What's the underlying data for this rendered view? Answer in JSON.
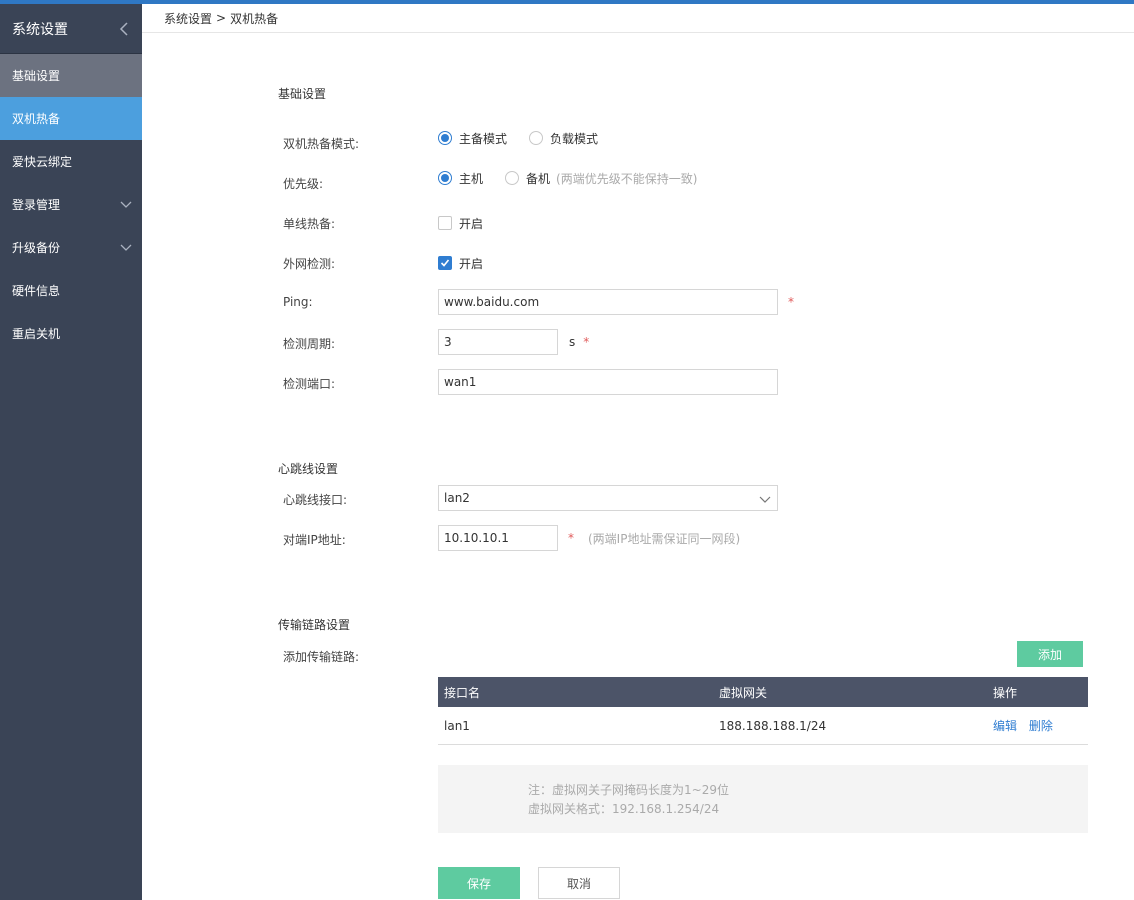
{
  "sidebar": {
    "title": "系统设置",
    "items": [
      {
        "label": "基础设置"
      },
      {
        "label": "双机热备"
      },
      {
        "label": "爱快云绑定"
      },
      {
        "label": "登录管理"
      },
      {
        "label": "升级备份"
      },
      {
        "label": "硬件信息"
      },
      {
        "label": "重启关机"
      }
    ]
  },
  "breadcrumb": {
    "parent": "系统设置",
    "separator": ">",
    "current": "双机热备"
  },
  "basic": {
    "title": "基础设置",
    "mode": {
      "label": "双机热备模式:",
      "options": [
        "主备模式",
        "负载模式"
      ],
      "selected": "主备模式"
    },
    "priority": {
      "label": "优先级:",
      "options": [
        "主机",
        "备机"
      ],
      "selected": "主机",
      "hint": "(两端优先级不能保持一致)"
    },
    "single_line": {
      "label": "单线热备:",
      "option": "开启",
      "checked": false
    },
    "wan_check": {
      "label": "外网检测:",
      "option": "开启",
      "checked": true
    },
    "ping": {
      "label": "Ping:",
      "value": "www.baidu.com",
      "required": "*"
    },
    "period": {
      "label": "检测周期:",
      "value": "3",
      "unit": "s",
      "required": "*"
    },
    "port": {
      "label": "检测端口:",
      "value": "wan1"
    }
  },
  "heartbeat": {
    "title": "心跳线设置",
    "interface": {
      "label": "心跳线接口:",
      "value": "lan2"
    },
    "peer_ip": {
      "label": "对端IP地址:",
      "value": "10.10.10.1",
      "required": "*",
      "hint": "(两端IP地址需保证同一网段)"
    }
  },
  "transport": {
    "title": "传输链路设置",
    "add_label": "添加传输链路:",
    "add_button": "添加",
    "columns": [
      "接口名",
      "虚拟网关",
      "操作"
    ],
    "rows": [
      {
        "name": "lan1",
        "gateway": "188.188.188.1/24",
        "edit": "编辑",
        "delete": "删除"
      }
    ],
    "note_line1": "注：虚拟网关子网掩码长度为1~29位",
    "note_line2": "虚拟网关格式：192.168.1.254/24"
  },
  "actions": {
    "save": "保存",
    "cancel": "取消"
  },
  "colors": {
    "sidebar_bg": "#3a4456",
    "active_item": "#4c9fde",
    "accent_green": "#5ecba0",
    "table_header": "#4c5468",
    "link": "#2f7dd1",
    "required": "#e05a5a"
  }
}
